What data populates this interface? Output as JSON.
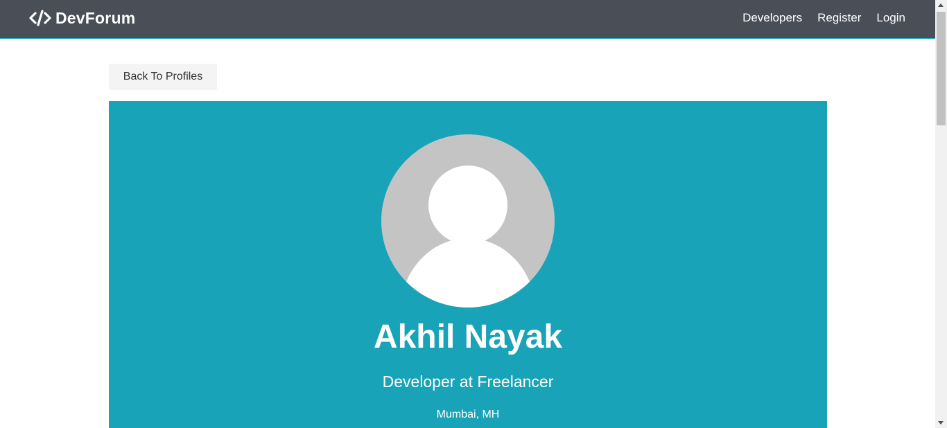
{
  "navbar": {
    "brand": "DevForum",
    "brand_icon": "code-icon",
    "links": [
      {
        "label": "Developers"
      },
      {
        "label": "Register"
      },
      {
        "label": "Login"
      }
    ]
  },
  "back_button": {
    "label": "Back To Profiles"
  },
  "profile": {
    "avatar_icon": "user-avatar-icon",
    "name": "Akhil Nayak",
    "title": "Developer at Freelancer",
    "location": "Mumbai, MH"
  },
  "colors": {
    "navbar_bg": "#4a4e57",
    "accent": "#19a3b8",
    "button_bg": "#f4f4f4"
  }
}
